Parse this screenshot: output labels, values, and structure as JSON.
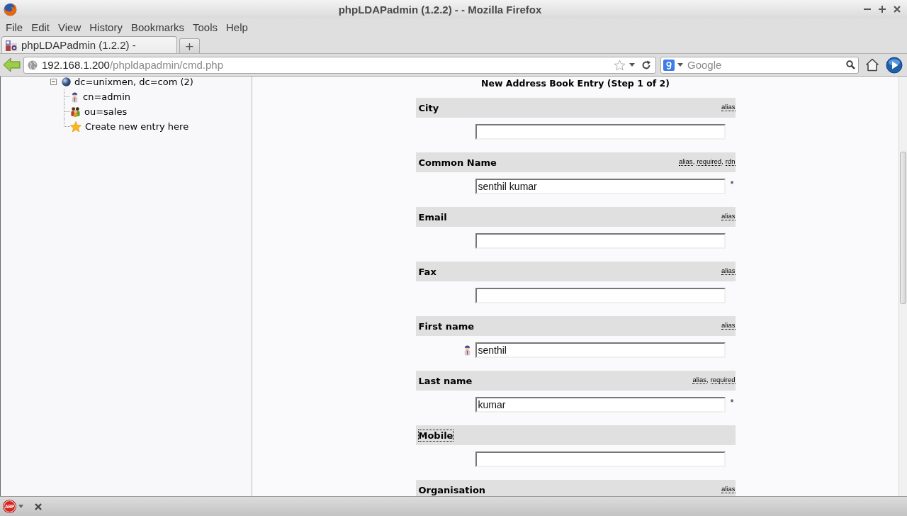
{
  "window": {
    "title": "phpLDAPadmin (1.2.2) - - Mozilla Firefox"
  },
  "menu_bar": [
    "File",
    "Edit",
    "View",
    "History",
    "Bookmarks",
    "Tools",
    "Help"
  ],
  "tabs": [
    {
      "label": "phpLDAPadmin (1.2.2) -",
      "selected": true
    }
  ],
  "new_tab": "+",
  "address_bar": {
    "host": "192.168.1.200",
    "path": "/phpldapadmin/cmd.php"
  },
  "search": {
    "placeholder": "Google"
  },
  "tree": {
    "label": "dc=unixmen, dc=com (2)",
    "expanded": true,
    "children": [
      {
        "label": "cn=admin",
        "kind": "person"
      },
      {
        "label": "ou=sales",
        "kind": "group"
      },
      {
        "label": "Create new entry here",
        "kind": "create"
      }
    ]
  },
  "form": {
    "heading": "New Address Book Entry (Step 1 of 2)",
    "tag_separator": ",",
    "required_mark": "*",
    "fields": [
      {
        "label": "City",
        "tags": [
          "alias"
        ],
        "required": false,
        "focused": false,
        "has_icon": false
      },
      {
        "label": "Common Name",
        "tags": [
          "alias",
          "required",
          "rdn"
        ],
        "value": "senthil kumar",
        "required": true,
        "focused": false,
        "has_icon": false
      },
      {
        "label": "Email",
        "tags": [
          "alias"
        ],
        "required": false,
        "focused": false,
        "has_icon": false
      },
      {
        "label": "Fax",
        "tags": [
          "alias"
        ],
        "required": false,
        "focused": false,
        "has_icon": false
      },
      {
        "label": "First name",
        "tags": [
          "alias"
        ],
        "value": "senthil",
        "required": false,
        "focused": false,
        "has_icon": true
      },
      {
        "label": "Last name",
        "tags": [
          "alias",
          "required"
        ],
        "value": "kumar",
        "required": true,
        "focused": false,
        "has_icon": false
      },
      {
        "label": "Mobile",
        "required": false,
        "focused": true,
        "has_icon": false
      },
      {
        "label": "Organisation",
        "tags": [
          "alias"
        ],
        "required": false,
        "focused": false,
        "has_icon": false
      }
    ]
  },
  "status_bar": {
    "addon": "ABP"
  }
}
